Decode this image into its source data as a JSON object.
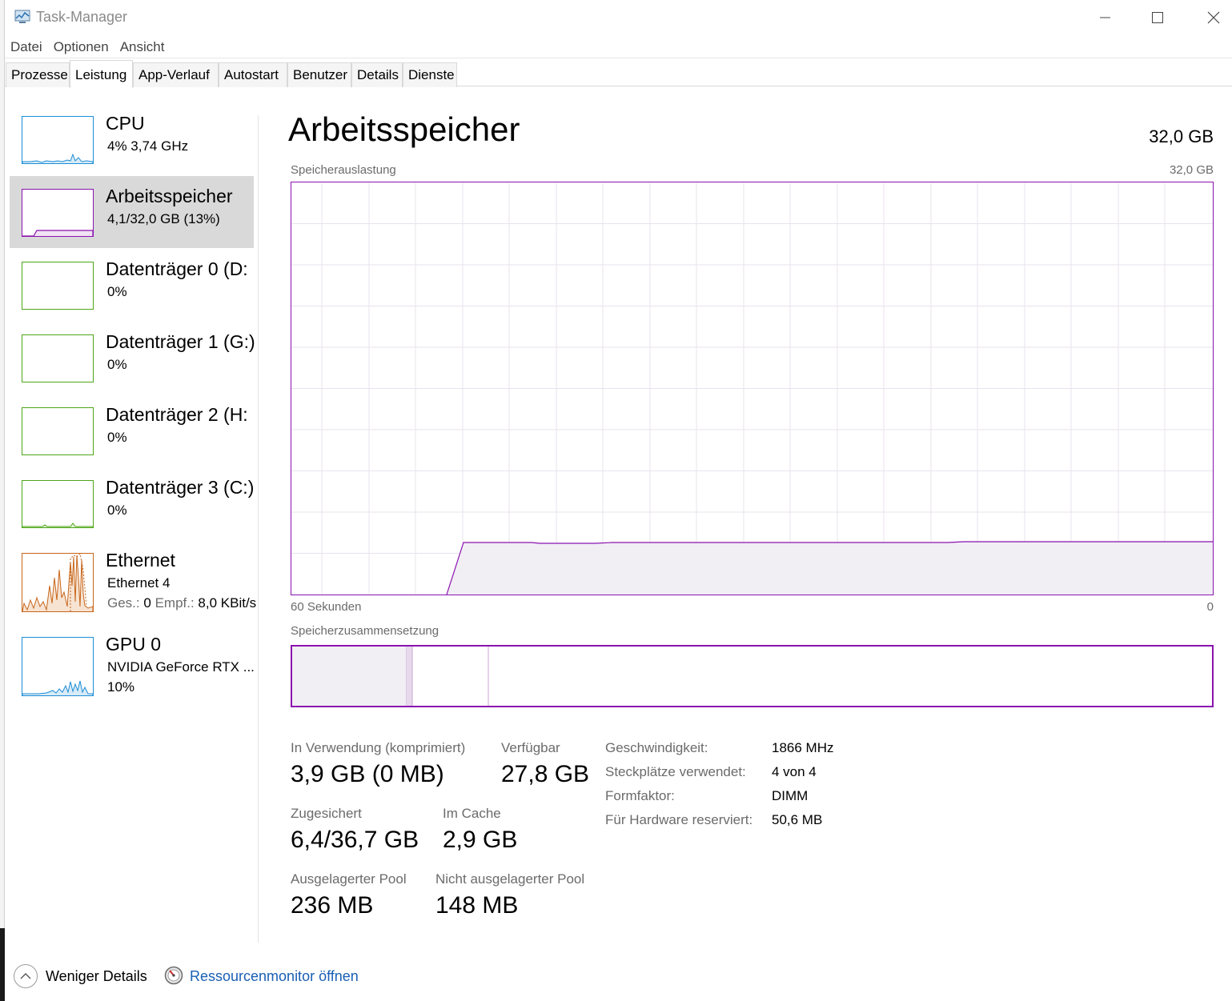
{
  "window": {
    "title": "Task-Manager"
  },
  "menu": [
    "Datei",
    "Optionen",
    "Ansicht"
  ],
  "tabs": [
    "Prozesse",
    "Leistung",
    "App-Verlauf",
    "Autostart",
    "Benutzer",
    "Details",
    "Dienste"
  ],
  "active_tab": "Leistung",
  "sidebar": {
    "items": [
      {
        "name": "CPU",
        "sub": "4%  3,74 GHz",
        "color": "#1c8dd6"
      },
      {
        "name": "Arbeitsspeicher",
        "sub": "4,1/32,0 GB (13%)",
        "color": "#8b12ae",
        "usage_fraction": 0.13
      },
      {
        "name": "Datenträger 0 (D:",
        "sub": "0%",
        "color": "#4da618"
      },
      {
        "name": "Datenträger 1 (G:)",
        "sub": "0%",
        "color": "#4da618"
      },
      {
        "name": "Datenträger 2 (H:",
        "sub": "0%",
        "color": "#4da618"
      },
      {
        "name": "Datenträger 3 (C:)",
        "sub": "0%",
        "color": "#4da618"
      },
      {
        "name": "Ethernet",
        "sub": "Ethernet 4",
        "sub2_label1": "Ges.:",
        "sub2_val1": "0",
        "sub2_label2": "Empf.:",
        "sub2_val2": "8,0 KBit/s",
        "color": "#c7661a"
      },
      {
        "name": "GPU 0",
        "sub": "NVIDIA GeForce RTX ...",
        "sub2": "10%",
        "color": "#1c8dd6"
      }
    ]
  },
  "main": {
    "title": "Arbeitsspeicher",
    "total": "32,0 GB",
    "chart_label": "Speicherauslastung",
    "chart_max": "32,0 GB",
    "chart_left": "60 Sekunden",
    "chart_right": "0",
    "composition_label": "Speicherzusammensetzung",
    "accent": "#8b12ae",
    "stats": {
      "in_use_label": "In Verwendung (komprimiert)",
      "in_use_value": "3,9 GB (0 MB)",
      "available_label": "Verfügbar",
      "available_value": "27,8 GB",
      "committed_label": "Zugesichert",
      "committed_value": "6,4/36,7 GB",
      "cached_label": "Im Cache",
      "cached_value": "2,9 GB",
      "paged_label": "Ausgelagerter Pool",
      "paged_value": "236 MB",
      "nonpaged_label": "Nicht ausgelagerter Pool",
      "nonpaged_value": "148 MB"
    },
    "specs": [
      {
        "label": "Geschwindigkeit:",
        "value": "1866 MHz"
      },
      {
        "label": "Steckplätze verwendet:",
        "value": "4 von 4"
      },
      {
        "label": "Formfaktor:",
        "value": "DIMM"
      },
      {
        "label": "Für Hardware reserviert:",
        "value": "50,6 MB"
      }
    ]
  },
  "footer": {
    "less_details": "Weniger Details",
    "resource_monitor": "Ressourcenmonitor öffnen"
  }
}
